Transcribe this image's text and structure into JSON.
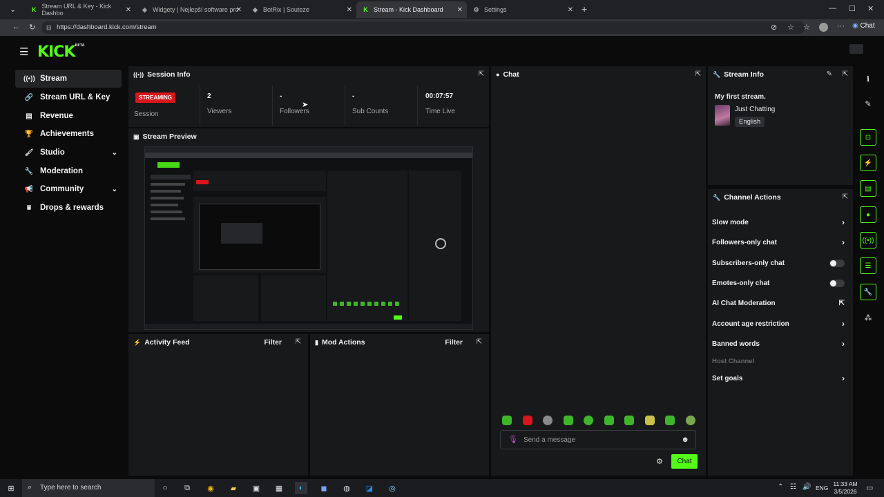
{
  "browser": {
    "tabs": [
      {
        "label": "Stream URL & Key - Kick Dashbo",
        "icon": "kick-icon",
        "active": false
      },
      {
        "label": "Widgety | Nejlepší software pro v",
        "icon": "widget-icon",
        "active": false
      },
      {
        "label": "BotRix | Souteze",
        "icon": "botrix-icon",
        "active": false
      },
      {
        "label": "Stream - Kick Dashboard",
        "icon": "kick-icon",
        "active": true
      },
      {
        "label": "Settings",
        "icon": "gear-icon",
        "active": false
      }
    ],
    "new_tab": "+",
    "url": "https://dashboard.kick.com/stream",
    "copilot_label": "Chat"
  },
  "logo": {
    "text": "KICK",
    "badge": "BETA"
  },
  "sidebar": {
    "items": [
      {
        "label": "Stream",
        "icon": "stream-icon",
        "active": true
      },
      {
        "label": "Stream URL & Key",
        "icon": "link-icon"
      },
      {
        "label": "Revenue",
        "icon": "revenue-icon"
      },
      {
        "label": "Achievements",
        "icon": "trophy-icon"
      },
      {
        "label": "Studio",
        "icon": "studio-icon",
        "expandable": true
      },
      {
        "label": "Moderation",
        "icon": "wrench-icon"
      },
      {
        "label": "Community",
        "icon": "community-icon",
        "expandable": true
      },
      {
        "label": "Drops & rewards",
        "icon": "drops-icon"
      }
    ]
  },
  "session": {
    "title": "Session Info",
    "badge": "STREAMING",
    "session_label": "Session",
    "stats": [
      {
        "value": "2",
        "label": "Viewers"
      },
      {
        "value": "-",
        "label": "Followers"
      },
      {
        "value": "-",
        "label": "Sub Counts"
      },
      {
        "value": "00:07:57",
        "label": "Time Live"
      }
    ]
  },
  "preview": {
    "title": "Stream Preview"
  },
  "activity": {
    "title": "Activity Feed",
    "filter": "Filter"
  },
  "mod_actions": {
    "title": "Mod Actions",
    "filter": "Filter"
  },
  "chat": {
    "title": "Chat",
    "placeholder": "Send a message",
    "send_label": "Chat"
  },
  "stream_info": {
    "title": "Stream Info",
    "stream_title": "My first stream.",
    "category": "Just Chatting",
    "language": "English"
  },
  "channel_actions": {
    "title": "Channel Actions",
    "items": [
      {
        "label": "Slow mode",
        "control": "arrow"
      },
      {
        "label": "Followers-only chat",
        "control": "arrow"
      },
      {
        "label": "Subscribers-only chat",
        "control": "toggle",
        "state": "off"
      },
      {
        "label": "Emotes-only chat",
        "control": "toggle",
        "state": "off"
      },
      {
        "label": "AI Chat Moderation",
        "control": "external"
      },
      {
        "label": "Account age restriction",
        "control": "arrow"
      },
      {
        "label": "Banned words",
        "control": "arrow"
      },
      {
        "label": "Host Channel",
        "control": "none",
        "disabled": true
      },
      {
        "label": "Set goals",
        "control": "arrow"
      }
    ]
  },
  "taskbar": {
    "search_placeholder": "Type here to search",
    "language": "ENG",
    "time": "11:33 AM",
    "date": "3/5/2026"
  },
  "colors": {
    "accent": "#53fc18",
    "streaming": "#d8161b",
    "panel": "#18191b",
    "background": "#0b0b0c"
  }
}
